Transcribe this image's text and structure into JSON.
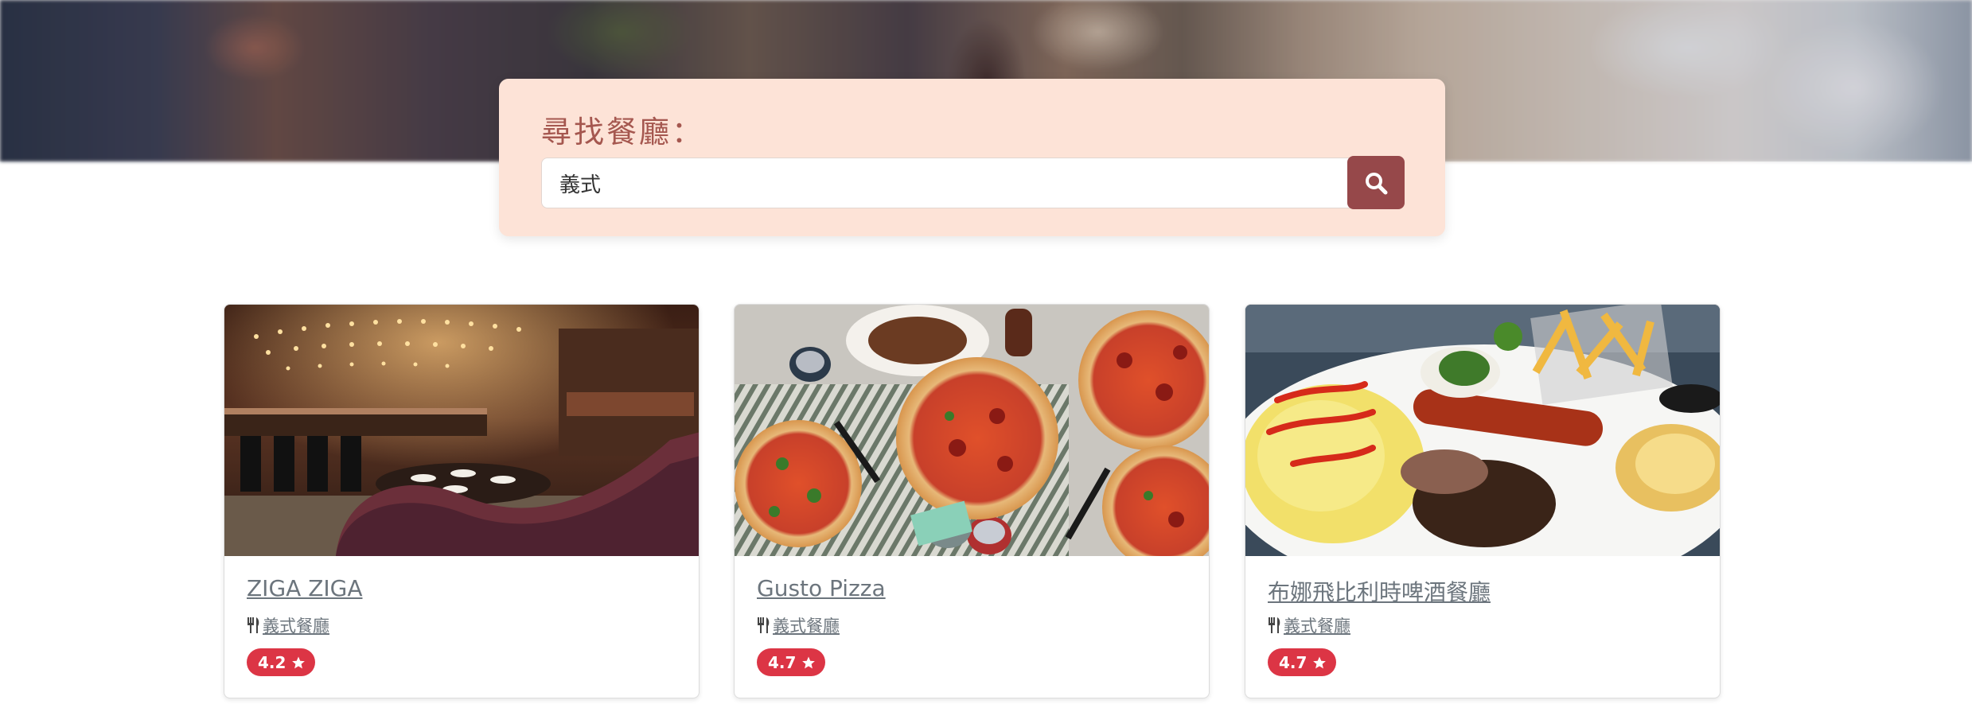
{
  "search": {
    "title": "尋找餐廳：",
    "value": "義式"
  },
  "restaurants": [
    {
      "name": "ZIGA ZIGA",
      "category": "義式餐廳",
      "rating": "4.2"
    },
    {
      "name": "Gusto Pizza",
      "category": "義式餐廳",
      "rating": "4.7"
    },
    {
      "name": "布娜飛比利時啤酒餐廳",
      "category": "義式餐廳",
      "rating": "4.7"
    }
  ],
  "colors": {
    "search_panel": "#fde3d7",
    "search_title": "#a5574f",
    "search_button": "#96484a",
    "rating_badge": "#dc3545",
    "link_text": "#6c757d"
  },
  "icons": {
    "search_button": "magnifier-icon",
    "category": "utensils-icon",
    "rating": "star-icon"
  }
}
